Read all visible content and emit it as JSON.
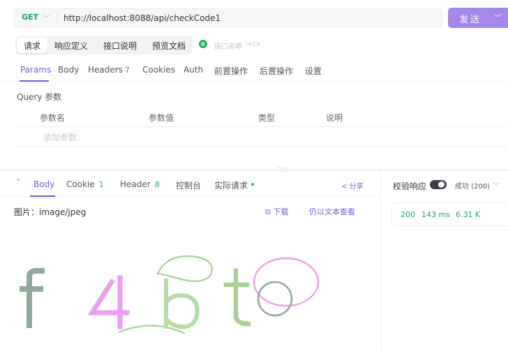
{
  "request": {
    "method": "GET",
    "url": "http://localhost:8088/api/checkCode1",
    "send_label": "发送"
  },
  "doc_tabs": [
    "请求",
    "响应定义",
    "接口说明",
    "预览文档"
  ],
  "api_name_placeholder": "接口名称",
  "api_code_symbol": "</>",
  "request_tabs": [
    {
      "label": "Params"
    },
    {
      "label": "Body"
    },
    {
      "label": "Headers",
      "badge": "7"
    },
    {
      "label": "Cookies"
    },
    {
      "label": "Auth"
    },
    {
      "label": "前置操作"
    },
    {
      "label": "后置操作"
    },
    {
      "label": "设置"
    }
  ],
  "query": {
    "title": "Query 参数",
    "columns": [
      "参数名",
      "参数值",
      "类型",
      "说明"
    ],
    "add_placeholder": "添加参数"
  },
  "splitter_dots": "···",
  "response": {
    "tabs": [
      {
        "label": "Body"
      },
      {
        "label": "Cookie",
        "badge": "1"
      },
      {
        "label": "Header",
        "badge": "8"
      },
      {
        "label": "控制台"
      },
      {
        "label": "实际请求"
      }
    ],
    "share_label": "分享",
    "content_type": "图片：image/jpeg",
    "download_label": "下载",
    "view_as_text_label": "仍以文本查看",
    "validate_label": "校验响应",
    "status_option": "成功 (200)",
    "status_code": "200",
    "time": "143 ms",
    "size": "6.31 K"
  },
  "captcha_image": {
    "glyph_colors": [
      "#8faa9b",
      "#ec9ef0",
      "#b4dca4",
      "#a9cf97",
      "#ef9fe5",
      "#93a89c"
    ]
  }
}
